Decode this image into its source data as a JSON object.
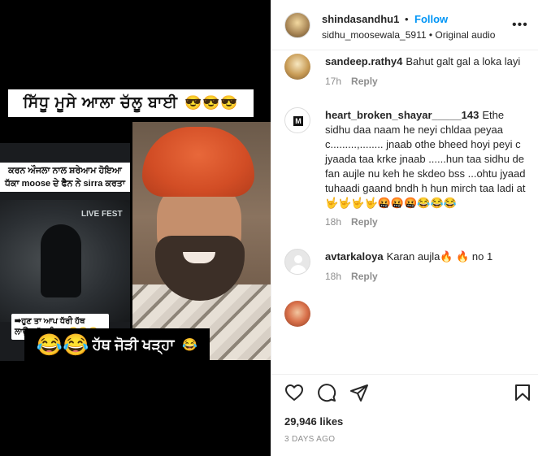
{
  "media": {
    "title_text": "ਸਿੱਧੂ ਮੂਸੇ ਆਲਾ ਚੱਲੂ ਬਾਈ",
    "title_emoji": "😎😎😎",
    "news_text": "ਕਰਨ ਔਜਲਾ ਨਾਲ ਸ਼ਰੇਆਮ ਹੋਇਆ ਧੱਕਾ moose ਦੇ ਫੈਨ ਨੇ sirra ਕਰਤਾ",
    "clip_sign": "LIVE FEST",
    "clip_caption": "➡ਹੁਣ ਤਾ ਆਪ ਧੱਰੀ ਹੱਥ ਲਾਉਣ ਲੱਗ ਪਿਆ 😂😂😂",
    "bottom_emoji": "😂😂",
    "bottom_text": "ਹੱਥ ਜੋੜੀ ਖੜ੍ਹਾ",
    "bottom_emoji2": "😂"
  },
  "header": {
    "username": "shindasandhu1",
    "separator": "•",
    "follow_label": "Follow",
    "subtitle": "sidhu_moosewala_5911 • Original audio",
    "more_glyph": "•••"
  },
  "comments": [
    {
      "username": "sandeep.rathy4",
      "text": "Bahut galt gal a loka layi",
      "time": "17h",
      "reply_label": "Reply"
    },
    {
      "username": "heart_broken_shayar_____143",
      "text": "Ethe sidhu daa naam he neyi chldaa peyaa c.........,........ jnaab othe bheed hoyi peyi c jyaada taa krke jnaab ......hun taa sidhu de fan aujle nu keh he skdeo bss ...ohtu jyaad tuhaadi gaand bndh h hun mirch taa ladi at🤟🤟🤟🤟🤬🤬🤬😂😂😂",
      "time": "18h",
      "reply_label": "Reply"
    },
    {
      "username": "avtarkaloya",
      "text": "Karan aujla🔥 🔥 no 1",
      "time": "18h",
      "reply_label": "Reply"
    }
  ],
  "stats": {
    "likes": "29,946 likes",
    "posted": "3 DAYS AGO"
  },
  "colors": {
    "accent": "#0095f6",
    "muted": "#8e8e8e",
    "text": "#262626"
  },
  "icons": [
    "heart-icon",
    "comment-icon",
    "share-icon",
    "bookmark-icon",
    "more-options-icon"
  ]
}
